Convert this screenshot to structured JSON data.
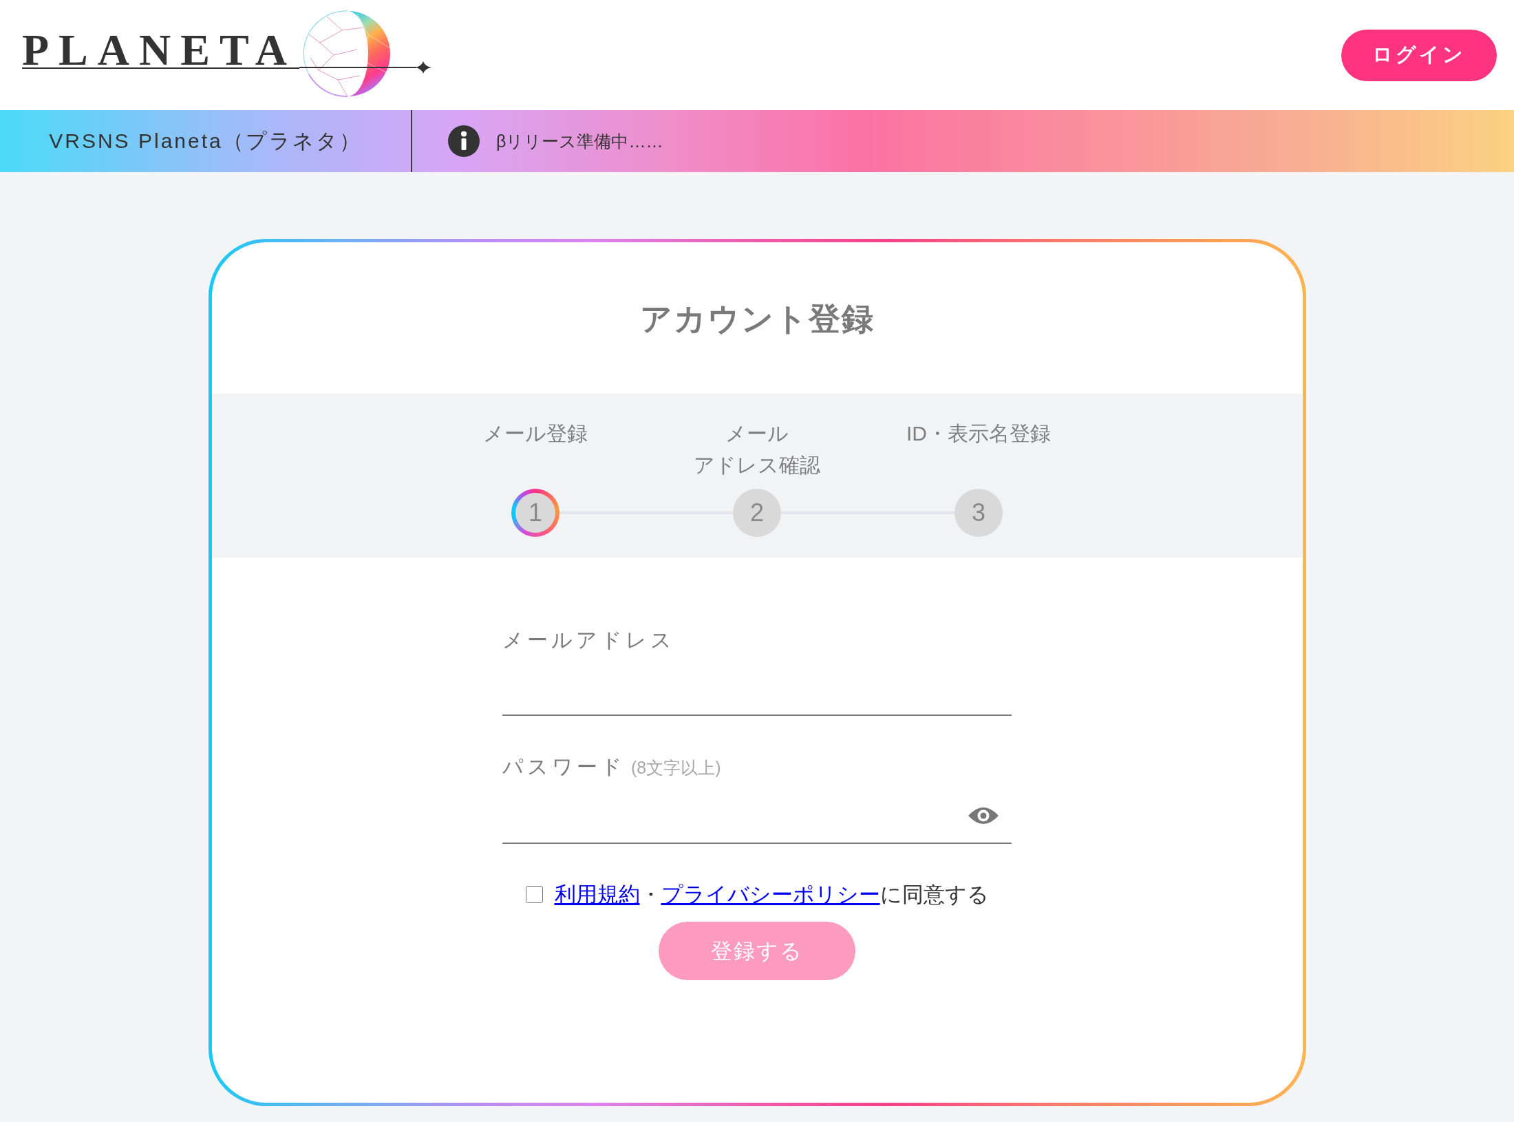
{
  "header": {
    "logo": {
      "wordmark": "PLANETA"
    },
    "login_button": {
      "label": "ログイン"
    }
  },
  "banner": {
    "site_name": "VRSNS Planeta（プラネタ）",
    "notice": "βリリース準備中……"
  },
  "registration": {
    "title": "アカウント登録",
    "steps": [
      {
        "label_lines": [
          "メール登録"
        ],
        "number": "1",
        "current": true
      },
      {
        "label_lines": [
          "メール",
          "アドレス確認"
        ],
        "number": "2",
        "current": false
      },
      {
        "label_lines": [
          "ID・表示名登録"
        ],
        "number": "3",
        "current": false
      }
    ],
    "fields": [
      {
        "kind": "email",
        "label": "メールアドレス"
      },
      {
        "kind": "password",
        "label": "パスワード",
        "hint": "(8文字以上)"
      }
    ],
    "agreement": {
      "checked": false,
      "parts": [
        {
          "kind": "link",
          "text": "利用規約"
        },
        {
          "kind": "text",
          "text": "・"
        },
        {
          "kind": "link",
          "text": "プライバシーポリシー"
        },
        {
          "kind": "text",
          "text": "に同意する"
        }
      ]
    },
    "submit_button": {
      "label": "登録する",
      "disabled": true
    }
  }
}
